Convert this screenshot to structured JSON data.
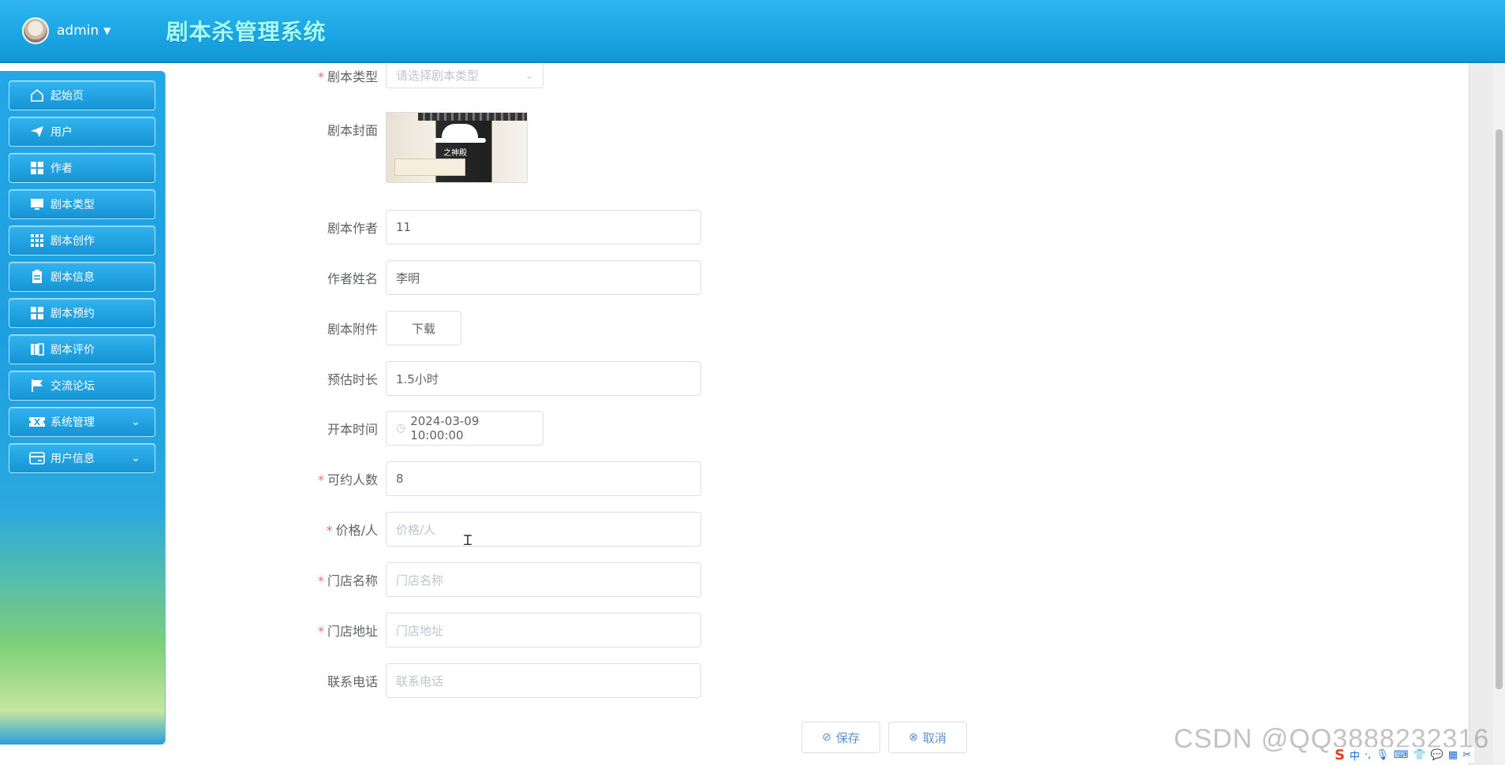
{
  "header": {
    "user_name": "admin",
    "app_title": "剧本杀管理系统"
  },
  "sidebar": {
    "items": [
      {
        "label": "起始页",
        "icon": "home-icon"
      },
      {
        "label": "用户",
        "icon": "paper-plane-icon"
      },
      {
        "label": "作者",
        "icon": "grid-icon"
      },
      {
        "label": "剧本类型",
        "icon": "monitor-icon"
      },
      {
        "label": "剧本创作",
        "icon": "apps-icon"
      },
      {
        "label": "剧本信息",
        "icon": "clipboard-icon"
      },
      {
        "label": "剧本预约",
        "icon": "grid-icon"
      },
      {
        "label": "剧本评价",
        "icon": "book-icon"
      },
      {
        "label": "交流论坛",
        "icon": "flag-icon"
      },
      {
        "label": "系统管理",
        "icon": "ticket-icon",
        "expandable": true
      },
      {
        "label": "用户信息",
        "icon": "card-icon",
        "expandable": true
      }
    ]
  },
  "form": {
    "script_type": {
      "label": "剧本类型",
      "placeholder": "请选择剧本类型",
      "required": true
    },
    "cover": {
      "label": "剧本封面",
      "image_text": "之神殿"
    },
    "author": {
      "label": "剧本作者",
      "value": "11"
    },
    "author_name": {
      "label": "作者姓名",
      "value": "李明"
    },
    "attachment": {
      "label": "剧本附件",
      "button": "下载"
    },
    "duration": {
      "label": "预估时长",
      "value": "1.5小时"
    },
    "open_time": {
      "label": "开本时间",
      "value": "2024-03-09 10:00:00"
    },
    "capacity": {
      "label": "可约人数",
      "value": "8",
      "required": true
    },
    "price": {
      "label": "价格/人",
      "placeholder": "价格/人",
      "required": true
    },
    "store_name": {
      "label": "门店名称",
      "placeholder": "门店名称",
      "required": true
    },
    "store_address": {
      "label": "门店地址",
      "placeholder": "门店地址",
      "required": true
    },
    "phone": {
      "label": "联系电话",
      "placeholder": "联系电话"
    }
  },
  "actions": {
    "save": "保存",
    "cancel": "取消"
  },
  "watermark": "CSDN @QQ3888232316",
  "ime": {
    "mode": "中"
  }
}
